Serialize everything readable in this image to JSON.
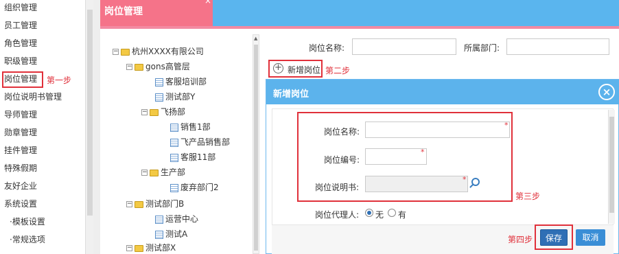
{
  "sidebar": {
    "items": [
      "组织管理",
      "员工管理",
      "角色管理",
      "职级管理",
      "岗位管理",
      "岗位说明书管理",
      "导师管理",
      "勋章管理",
      "挂件管理",
      "特殊假期",
      "友好企业",
      "系统设置"
    ],
    "sub_items": [
      "·模板设置",
      "·常规选项"
    ],
    "step1": "第一步"
  },
  "panel": {
    "title": "岗位管理",
    "close": "×"
  },
  "tree": {
    "nodes": [
      {
        "label": "杭州XXXX有限公司",
        "kind": "folder",
        "toggle": "−"
      },
      {
        "label": "gons高管层",
        "kind": "folder",
        "toggle": "−"
      },
      {
        "label": "客服培训部",
        "kind": "doc"
      },
      {
        "label": "测试部Y",
        "kind": "doc"
      },
      {
        "label": "飞扬部",
        "kind": "folder",
        "toggle": "−"
      },
      {
        "label": "销售1部",
        "kind": "doc"
      },
      {
        "label": "飞产品销售部",
        "kind": "doc"
      },
      {
        "label": "客服11部",
        "kind": "doc"
      },
      {
        "label": "生产部",
        "kind": "folder",
        "toggle": "−"
      },
      {
        "label": "废弃部门2",
        "kind": "doc"
      },
      {
        "label": "测试部门B",
        "kind": "folder",
        "toggle": "−"
      },
      {
        "label": "运营中心",
        "kind": "doc"
      },
      {
        "label": "测试A",
        "kind": "doc"
      },
      {
        "label": "测试部X",
        "kind": "folder",
        "toggle": "−"
      }
    ]
  },
  "search": {
    "name_label": "岗位名称:",
    "dept_label": "所属部门:",
    "name_value": "",
    "dept_value": ""
  },
  "toolbar": {
    "add_label": "新增岗位",
    "step2": "第二步"
  },
  "dialog": {
    "title": "新增岗位",
    "close": "×",
    "fields": {
      "name_label": "岗位名称:",
      "code_label": "岗位编号:",
      "desc_label": "岗位说明书:",
      "agent_label": "岗位代理人:",
      "required_mark": "*"
    },
    "agent_options": [
      "无",
      "有"
    ],
    "step3": "第三步",
    "step4": "第四步",
    "save_label": "保存",
    "cancel_label": "取消"
  },
  "colors": {
    "panel_head": "#f57389",
    "dialog_head": "#5cb3ec",
    "annotation": "#e0303a",
    "primary_button": "#2f6fb5"
  }
}
